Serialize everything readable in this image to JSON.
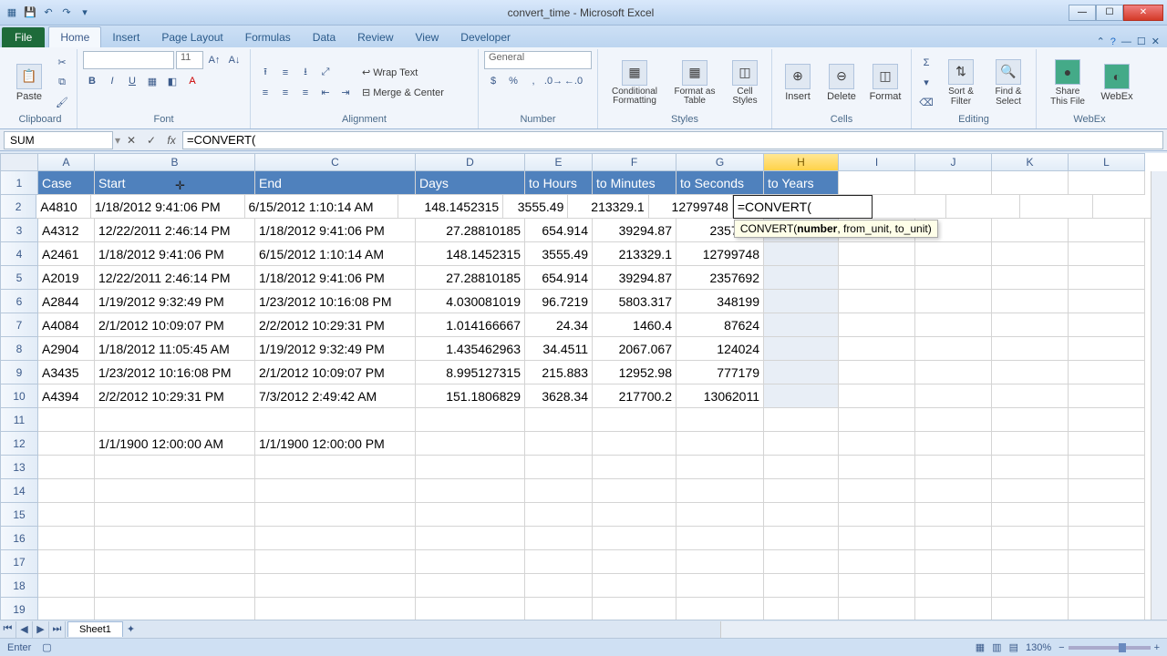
{
  "window": {
    "title": "convert_time - Microsoft Excel"
  },
  "tabs": {
    "file": "File",
    "home": "Home",
    "insert": "Insert",
    "page_layout": "Page Layout",
    "formulas": "Formulas",
    "data": "Data",
    "review": "Review",
    "view": "View",
    "developer": "Developer"
  },
  "ribbon": {
    "clipboard": {
      "label": "Clipboard",
      "paste": "Paste"
    },
    "font": {
      "label": "Font",
      "size": "11"
    },
    "alignment": {
      "label": "Alignment",
      "wrap": "Wrap Text",
      "merge": "Merge & Center"
    },
    "number": {
      "label": "Number",
      "format": "General"
    },
    "styles": {
      "label": "Styles",
      "cond": "Conditional Formatting",
      "fmt": "Format as Table",
      "cell": "Cell Styles"
    },
    "cells": {
      "label": "Cells",
      "insert": "Insert",
      "delete": "Delete",
      "format": "Format"
    },
    "editing": {
      "label": "Editing",
      "sort": "Sort & Filter",
      "find": "Find & Select"
    },
    "share": {
      "label": "WebEx",
      "share": "Share This File",
      "webex": "WebEx"
    }
  },
  "namebox": "SUM",
  "formula": "=CONVERT(",
  "tooltip": {
    "fn": "CONVERT(",
    "arg1": "number",
    "rest": ", from_unit, to_unit)"
  },
  "cols": [
    "A",
    "B",
    "C",
    "D",
    "E",
    "F",
    "G",
    "H",
    "I",
    "J",
    "K",
    "L"
  ],
  "colwidths": [
    "colA",
    "colB",
    "colC",
    "colD",
    "colE",
    "colF",
    "colG",
    "colH",
    "colI",
    "colJ",
    "colK",
    "colL"
  ],
  "headers": {
    "A": "Case",
    "B": "Start",
    "C": "End",
    "D": "Days",
    "E": "to Hours",
    "F": "to Minutes",
    "G": "to Seconds",
    "H": "to Years"
  },
  "rows": [
    {
      "n": 2,
      "A": "A4810",
      "B": "1/18/2012 9:41:06 PM",
      "C": "6/15/2012 1:10:14 AM",
      "D": "148.1452315",
      "E": "3555.49",
      "F": "213329.1",
      "G": "12799748",
      "Hedit": "=CONVERT("
    },
    {
      "n": 3,
      "A": "A4312",
      "B": "12/22/2011 2:46:14 PM",
      "C": "1/18/2012 9:41:06 PM",
      "D": "27.28810185",
      "E": "654.914",
      "F": "39294.87",
      "G": "2357692"
    },
    {
      "n": 4,
      "A": "A2461",
      "B": "1/18/2012 9:41:06 PM",
      "C": "6/15/2012 1:10:14 AM",
      "D": "148.1452315",
      "E": "3555.49",
      "F": "213329.1",
      "G": "12799748"
    },
    {
      "n": 5,
      "A": "A2019",
      "B": "12/22/2011 2:46:14 PM",
      "C": "1/18/2012 9:41:06 PM",
      "D": "27.28810185",
      "E": "654.914",
      "F": "39294.87",
      "G": "2357692"
    },
    {
      "n": 6,
      "A": "A2844",
      "B": "1/19/2012 9:32:49 PM",
      "C": "1/23/2012 10:16:08 PM",
      "D": "4.030081019",
      "E": "96.7219",
      "F": "5803.317",
      "G": "348199"
    },
    {
      "n": 7,
      "A": "A4084",
      "B": "2/1/2012 10:09:07 PM",
      "C": "2/2/2012 10:29:31 PM",
      "D": "1.014166667",
      "E": "24.34",
      "F": "1460.4",
      "G": "87624"
    },
    {
      "n": 8,
      "A": "A2904",
      "B": "1/18/2012 11:05:45 AM",
      "C": "1/19/2012 9:32:49 PM",
      "D": "1.435462963",
      "E": "34.4511",
      "F": "2067.067",
      "G": "124024"
    },
    {
      "n": 9,
      "A": "A3435",
      "B": "1/23/2012 10:16:08 PM",
      "C": "2/1/2012 10:09:07 PM",
      "D": "8.995127315",
      "E": "215.883",
      "F": "12952.98",
      "G": "777179"
    },
    {
      "n": 10,
      "A": "A4394",
      "B": "2/2/2012 10:29:31 PM",
      "C": "7/3/2012 2:49:42 AM",
      "D": "151.1806829",
      "E": "3628.34",
      "F": "217700.2",
      "G": "13062011"
    },
    {
      "n": 11
    },
    {
      "n": 12,
      "B": "1/1/1900 12:00:00 AM",
      "C": "1/1/1900 12:00:00 PM"
    },
    {
      "n": 13
    },
    {
      "n": 14
    },
    {
      "n": 15
    },
    {
      "n": 16
    },
    {
      "n": 17
    },
    {
      "n": 18
    },
    {
      "n": 19
    }
  ],
  "sheet": "Sheet1",
  "status": {
    "mode": "Enter",
    "zoom": "130%"
  }
}
